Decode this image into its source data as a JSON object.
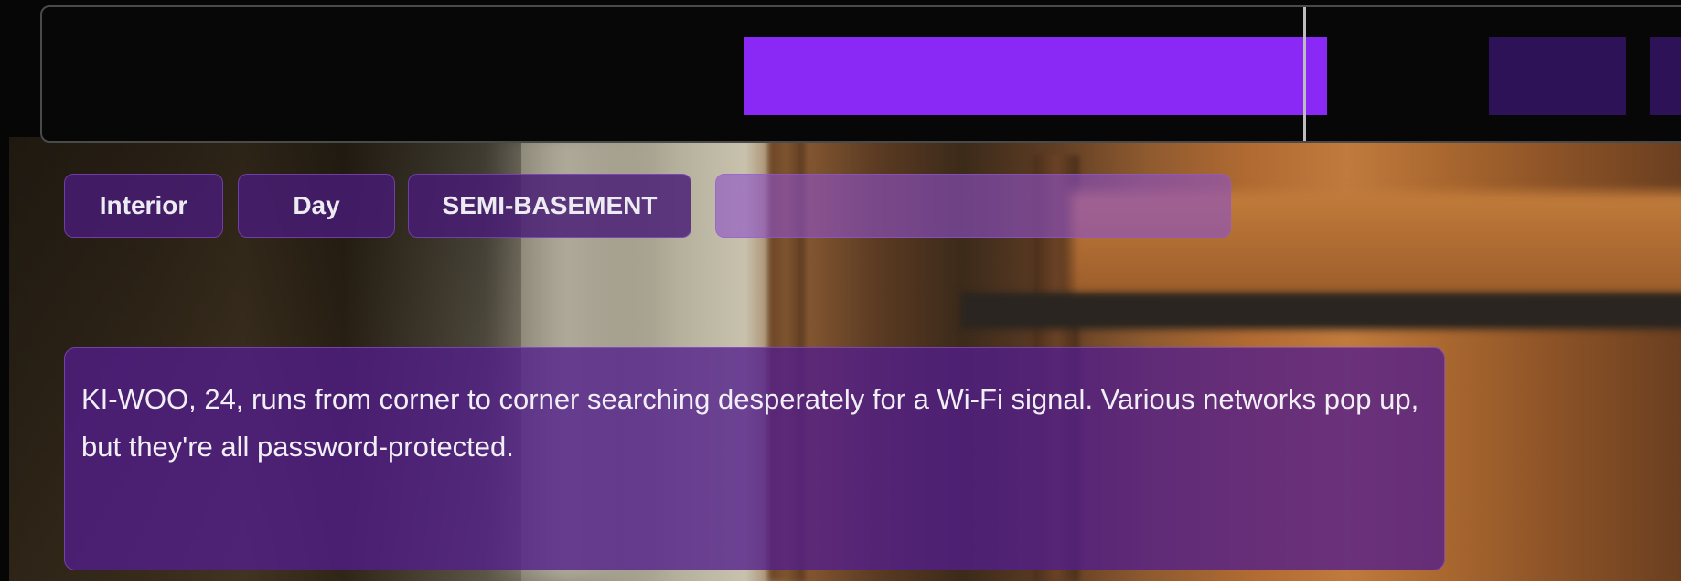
{
  "timeline": {
    "blocks": [
      "active-scene",
      "upcoming-scene",
      "upcoming-scene"
    ]
  },
  "scene_heading": {
    "chips": [
      "Interior",
      "Day",
      "SEMI-BASEMENT",
      ""
    ]
  },
  "action": {
    "text": "KI-WOO, 24, runs from corner to corner searching desperately for a Wi-Fi signal. Various networks pop up, but they're all password-protected."
  },
  "colors": {
    "accent": "#8a28f5",
    "chip_bg": "#481c76",
    "timeline_bg": "#070707"
  }
}
